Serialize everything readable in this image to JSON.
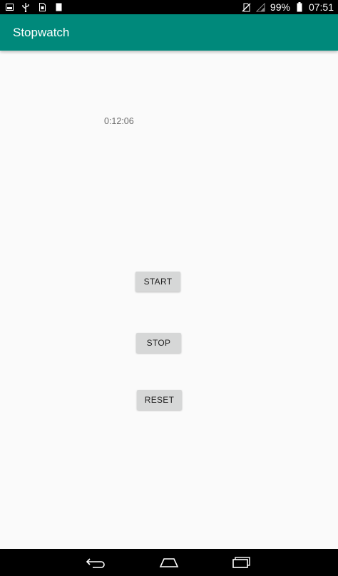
{
  "status_bar": {
    "battery_percent": "99%",
    "time": "07:51",
    "icons_left": [
      "image-icon",
      "usb-icon",
      "sim-icon",
      "sd-card-icon"
    ],
    "icons_right": [
      "no-sim-icon",
      "signal-icon",
      "battery-icon"
    ]
  },
  "app_bar": {
    "title": "Stopwatch",
    "color": "#00897b"
  },
  "stopwatch": {
    "time": "0:12:06"
  },
  "buttons": {
    "start": "START",
    "stop": "STOP",
    "reset": "RESET"
  },
  "nav_bar": {
    "icons": [
      "back-icon",
      "home-icon",
      "recents-icon"
    ]
  }
}
